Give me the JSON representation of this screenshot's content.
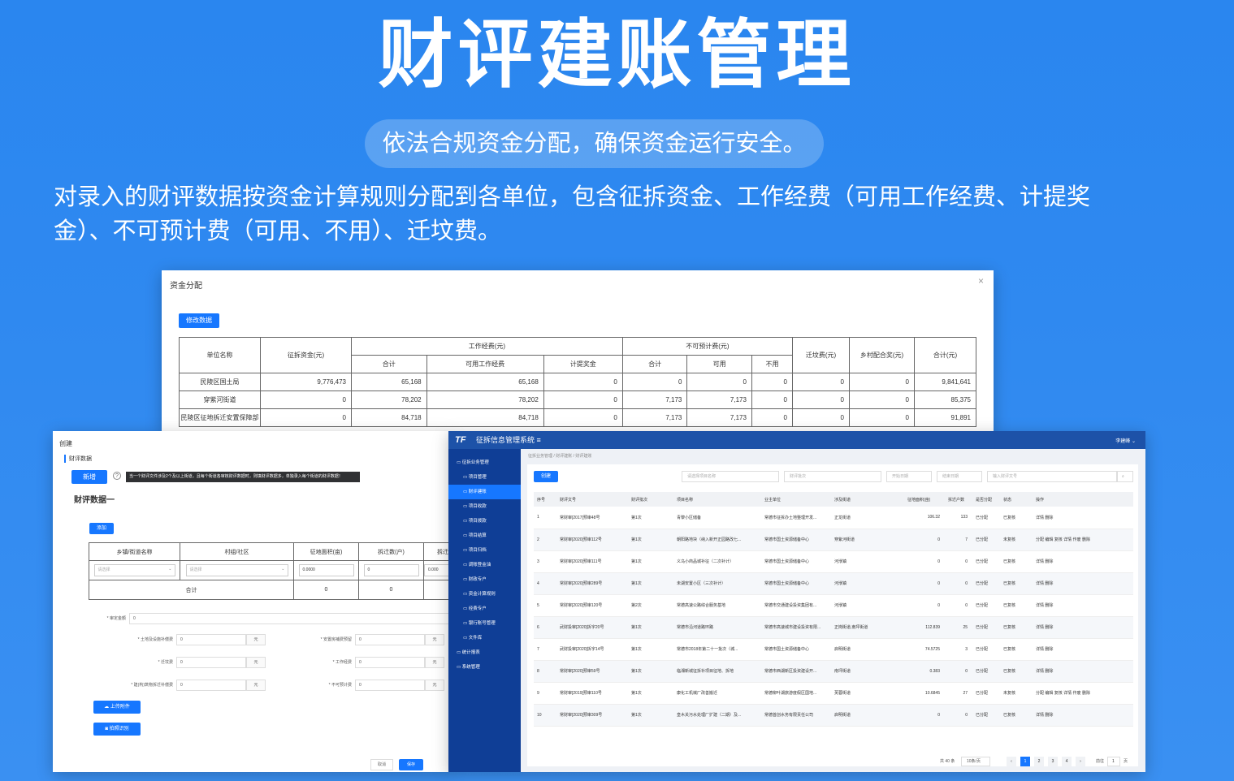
{
  "hero": {
    "title": "财评建账管理",
    "slogan": "依法合规资金分配，确保资金运行安全。",
    "description": "对录入的财评数据按资金计算规则分配到各单位，包含征拆资金、工作经费（可用工作经费、计提奖金）、不可预计费（可用、不用）、迁坟费。"
  },
  "alloc": {
    "title": "资金分配",
    "close": "×",
    "edit_button": "修改数据",
    "headers": {
      "unit": "单位名称",
      "demolition": "征拆资金(元)",
      "work_fund": "工作经费(元)",
      "work_total": "合计",
      "work_usable": "可用工作经费",
      "work_bonus": "计提奖金",
      "unforeseen": "不可预计费(元)",
      "unf_total": "合计",
      "unf_usable": "可用",
      "unf_unused": "不用",
      "grave": "迁坟费(元)",
      "village": "乡村配合奖(元)",
      "total": "合计(元)"
    },
    "rows": [
      [
        "民陵区国土局",
        "9,776,473",
        "65,168",
        "65,168",
        "0",
        "0",
        "0",
        "0",
        "0",
        "0",
        "9,841,641"
      ],
      [
        "穿紫河街道",
        "0",
        "78,202",
        "78,202",
        "0",
        "7,173",
        "7,173",
        "0",
        "0",
        "0",
        "85,375"
      ],
      [
        "民陵区征地拆迁安置保障部",
        "0",
        "84,718",
        "84,718",
        "0",
        "7,173",
        "7,173",
        "0",
        "0",
        "0",
        "91,891"
      ]
    ]
  },
  "create": {
    "title": "创建",
    "subtitle": "财评数据",
    "add_button": "新增",
    "tip_icon": "?",
    "tip": "当一个财评文件涉及2个及以上街道，且每个街道各审核财评数据时，则填财评数据多，单独录入每个街道的财评数据！",
    "section": "财评数据一",
    "add_small": "添加",
    "headers": [
      "乡镇/街道名称",
      "村组/社区",
      "征地面积(亩)",
      "拆迁数(户)",
      "拆迁"
    ],
    "row": {
      "town_placeholder": "请选择",
      "village_placeholder": "请选择",
      "area": "0.0000",
      "count": "0",
      "extra": "0.000"
    },
    "total_row": {
      "label": "合计",
      "area": "0",
      "count": "0"
    },
    "amount_label": "* 审定金额",
    "amount_value": "0",
    "fields": [
      {
        "label": "* 土地及设施补偿费",
        "value": "0",
        "unit": "元"
      },
      {
        "label": "* 安置房補费预留",
        "value": "0",
        "unit": "元"
      },
      {
        "label": "* 迁坟费",
        "value": "0",
        "unit": "元"
      },
      {
        "label": "* 工作经费",
        "value": "0",
        "unit": "元"
      },
      {
        "label": "* 建(构)筑物拆迁补偿费",
        "value": "0",
        "unit": "元"
      },
      {
        "label": "* 不可预计费",
        "value": "0",
        "unit": "元"
      }
    ],
    "upload_button": "上传附件",
    "photo_button": "拍照识别",
    "cancel": "取消",
    "save": "保存"
  },
  "system": {
    "logo": "TF",
    "name": "征拆信息管理系统",
    "name_icon": "≡",
    "user": "李建峰 ⌄",
    "sidebar": [
      "征拆业务管理",
      "项目管理",
      "财评建账",
      "项目收款",
      "项目拨款",
      "项目结算",
      "项目归档",
      "调账登金油",
      "财政专户",
      "资金计算规则",
      "经费专户",
      "银行账号管理",
      "文件库",
      "统计报表",
      "系统管理"
    ],
    "breadcrumb": "征拆业务管理 / 财评建账 / 财评建账",
    "new_button": "创建",
    "filters": [
      "请选择项目名称",
      "财评批次",
      "开始日期",
      "结束日期",
      "输入财评文号"
    ],
    "search_icon": "⌕",
    "headers": [
      "序号",
      "财评文号",
      "财评批次",
      "项目名称",
      "业主单位",
      "涉及街道",
      "征地面积(亩)",
      "拆迁户数",
      "是否分配",
      "状态",
      "操作"
    ],
    "rows": [
      [
        "1",
        "常财审[2017]预审48号",
        "第1次",
        "青黎小区储备",
        "常德市征拆办土地整理开发...",
        "正龙街道",
        "106.32",
        "133",
        "已分配",
        "已复核",
        "详情 删除"
      ],
      [
        "2",
        "常财审[2020]预审112号",
        "第1次",
        "朝阳路地块（纳入新开正园路改七...",
        "常德市国土资源储备中心",
        "穿紫河街道",
        "0",
        "7",
        "已分配",
        "未复核",
        "分配 编辑 复核 详情 作废 删除"
      ],
      [
        "3",
        "常财审[2020]预审111号",
        "第1次",
        "义乌小商品城补征（二次补计）",
        "常德市国土资源储备中心",
        "河洑镇",
        "0",
        "0",
        "已分配",
        "已复核",
        "详情 删除"
      ],
      [
        "4",
        "常财审[2020]预审289号",
        "第1次",
        "未湖安置小区（三次补计）",
        "常德市国土资源储备中心",
        "河洑镇",
        "0",
        "0",
        "已分配",
        "已复核",
        "详情 删除"
      ],
      [
        "5",
        "常财审[2020]预审120号",
        "第2次",
        "常德高速公路综合服务基地",
        "常德市交通建设投资集团有...",
        "河洑镇",
        "0",
        "0",
        "已分配",
        "已复核",
        "详情 删除"
      ],
      [
        "6",
        "武财投审[2020]拆字20号",
        "第1次",
        "常德市沿河道路环路",
        "常德市高速城市建设投资有限...",
        "正岗街道,南坪街道",
        "112.839",
        "25",
        "已分配",
        "已复核",
        "详情 删除"
      ],
      [
        "7",
        "武财投审[2020]拆字14号",
        "第1次",
        "常德市2018年第二十一批次（城...",
        "常德市国土资源储备中心",
        "启明街道",
        "74.5725",
        "3",
        "已分配",
        "已复核",
        "详情 删除"
      ],
      [
        "8",
        "常财审[2020]预审59号",
        "第1次",
        "临湘新城征拆补项目征地、拆地",
        "常德市西湖新区投资建设开...",
        "南坪街道",
        "0.383",
        "0",
        "已分配",
        "已复核",
        "详情 删除"
      ],
      [
        "9",
        "常财审[2019]预审110号",
        "第1次",
        "康化工机械厂改善搬迁",
        "常德柳叶湖旅游度假区国地...",
        "芙蓉街道",
        "10.6845",
        "27",
        "已分配",
        "未复核",
        "分配 编辑 复核 详情 作废 删除"
      ],
      [
        "10",
        "常财审[2020]预审309号",
        "第1次",
        "皇木关污水处理厂扩建（二期）及...",
        "常德首创水务有限责任公司",
        "启明街道",
        "0",
        "0",
        "已分配",
        "已复核",
        "详情 删除"
      ]
    ],
    "pagination": {
      "total": "共 40 条",
      "size": "10条/页",
      "prev": "‹",
      "pages": [
        "1",
        "2",
        "3",
        "4"
      ],
      "next": "›",
      "goto": "前往",
      "goto_value": "1",
      "goto_unit": "页"
    }
  }
}
